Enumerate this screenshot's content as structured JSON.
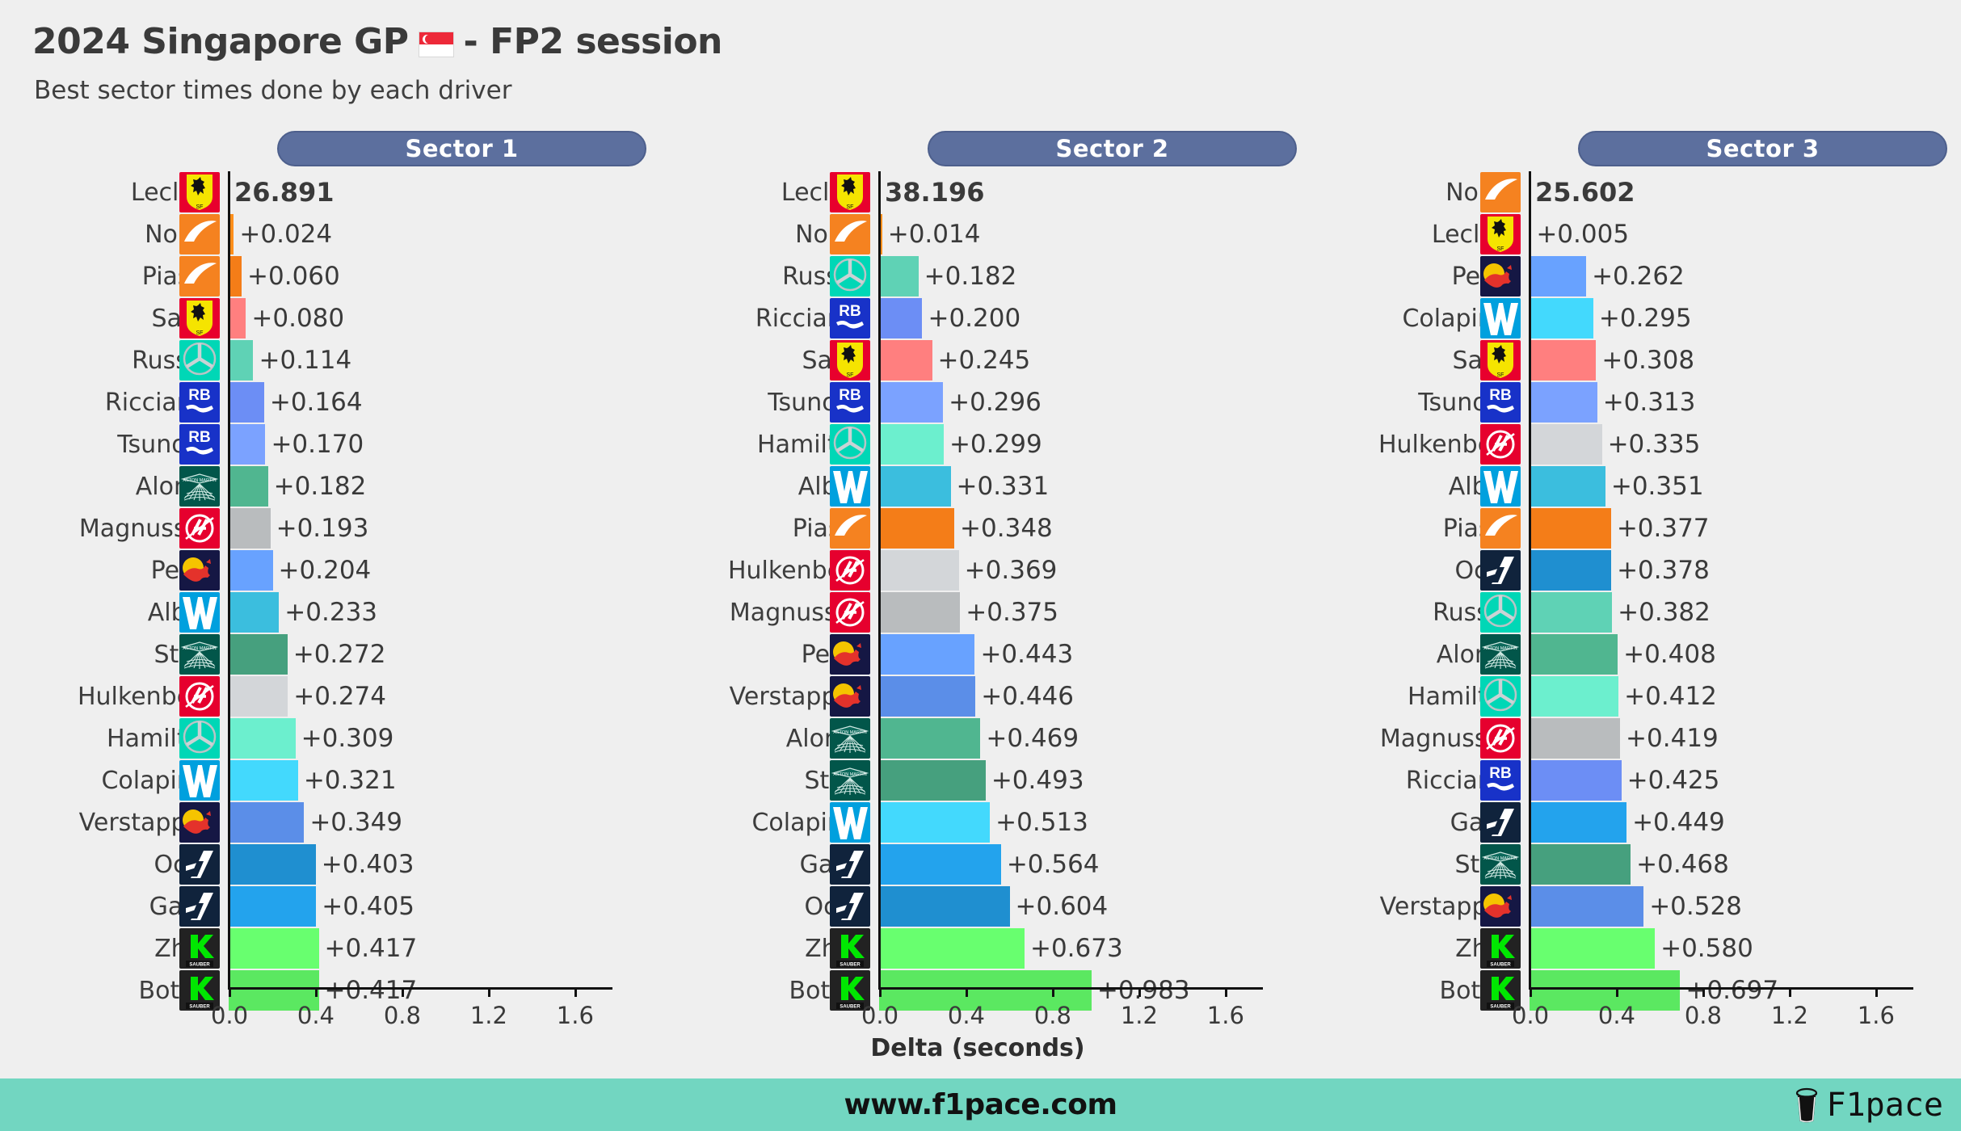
{
  "header": {
    "title_prefix": "2024 Singapore GP",
    "flag": "singapore-flag",
    "title_suffix": "- FP2 session",
    "subtitle": "Best sector times done by each driver"
  },
  "axis": {
    "xlabel": "Delta (seconds)",
    "ticks": [
      "0.0",
      "0.4",
      "0.8",
      "1.2",
      "1.6"
    ],
    "tick_values": [
      0.0,
      0.4,
      0.8,
      1.2,
      1.6
    ],
    "xlim": [
      0.0,
      1.78
    ]
  },
  "footer": {
    "url": "www.f1pace.com",
    "brand": "F1pace",
    "brand_icon": "coffee-cup-icon",
    "background": "#72d6c1"
  },
  "teams": {
    "ferrari": {
      "bar": "#ff6f6f",
      "logo_bg": "#e8002d"
    },
    "mclaren": {
      "bar": "#f47d18",
      "logo_bg": "#f58220"
    },
    "mercedes": {
      "bar": "#5fd2b5",
      "logo_bg": "#00d7b6"
    },
    "rb": {
      "bar": "#6c8ef5",
      "logo_bg": "#1832c8"
    },
    "astonmartin": {
      "bar": "#46a07e",
      "logo_bg": "#02564a"
    },
    "haas": {
      "bar": "#b9bcbe",
      "logo_bg": "#e6002e"
    },
    "redbull": {
      "bar": "#5b8ee8",
      "logo_bg": "#151744"
    },
    "williams": {
      "bar": "#3bbede",
      "logo_bg": "#00a0de"
    },
    "alpine": {
      "bar": "#1f8fd0",
      "logo_bg": "#10233c"
    },
    "sauber": {
      "bar": "#5be861",
      "logo_bg": "#222222"
    }
  },
  "chart_data": {
    "type": "bar",
    "title": "2024 Singapore GP - FP2 session",
    "subtitle": "Best sector times done by each driver",
    "xlabel": "Delta (seconds)",
    "ylabel": "",
    "xlim": [
      0.0,
      1.78
    ],
    "grid": false,
    "legend": "none",
    "orientation": "horizontal",
    "panels": [
      {
        "label": "Sector 1",
        "leader_time": "26.891",
        "rows": [
          {
            "driver": "Leclerc",
            "team": "ferrari",
            "delta": 0.0,
            "label": "26.891",
            "leader": true,
            "bar_shade": "dark"
          },
          {
            "driver": "Norris",
            "team": "mclaren",
            "delta": 0.024,
            "label": "+0.024",
            "leader": false,
            "bar_shade": "light"
          },
          {
            "driver": "Piastri",
            "team": "mclaren",
            "delta": 0.06,
            "label": "+0.060",
            "leader": false,
            "bar_shade": "dark"
          },
          {
            "driver": "Sainz",
            "team": "ferrari",
            "delta": 0.08,
            "label": "+0.080",
            "leader": false,
            "bar_shade": "light"
          },
          {
            "driver": "Russell",
            "team": "mercedes",
            "delta": 0.114,
            "label": "+0.114",
            "leader": false,
            "bar_shade": "dark"
          },
          {
            "driver": "Ricciardo",
            "team": "rb",
            "delta": 0.164,
            "label": "+0.164",
            "leader": false,
            "bar_shade": "dark"
          },
          {
            "driver": "Tsunoda",
            "team": "rb",
            "delta": 0.17,
            "label": "+0.170",
            "leader": false,
            "bar_shade": "light"
          },
          {
            "driver": "Alonso",
            "team": "astonmartin",
            "delta": 0.182,
            "label": "+0.182",
            "leader": false,
            "bar_shade": "light"
          },
          {
            "driver": "Magnussen",
            "team": "haas",
            "delta": 0.193,
            "label": "+0.193",
            "leader": false,
            "bar_shade": "dark"
          },
          {
            "driver": "Perez",
            "team": "redbull",
            "delta": 0.204,
            "label": "+0.204",
            "leader": false,
            "bar_shade": "light"
          },
          {
            "driver": "Albon",
            "team": "williams",
            "delta": 0.233,
            "label": "+0.233",
            "leader": false,
            "bar_shade": "dark"
          },
          {
            "driver": "Stroll",
            "team": "astonmartin",
            "delta": 0.272,
            "label": "+0.272",
            "leader": false,
            "bar_shade": "dark"
          },
          {
            "driver": "Hulkenberg",
            "team": "haas",
            "delta": 0.274,
            "label": "+0.274",
            "leader": false,
            "bar_shade": "light"
          },
          {
            "driver": "Hamilton",
            "team": "mercedes",
            "delta": 0.309,
            "label": "+0.309",
            "leader": false,
            "bar_shade": "light"
          },
          {
            "driver": "Colapinto",
            "team": "williams",
            "delta": 0.321,
            "label": "+0.321",
            "leader": false,
            "bar_shade": "light"
          },
          {
            "driver": "Verstappen",
            "team": "redbull",
            "delta": 0.349,
            "label": "+0.349",
            "leader": false,
            "bar_shade": "dark"
          },
          {
            "driver": "Ocon",
            "team": "alpine",
            "delta": 0.403,
            "label": "+0.403",
            "leader": false,
            "bar_shade": "dark"
          },
          {
            "driver": "Gasly",
            "team": "alpine",
            "delta": 0.405,
            "label": "+0.405",
            "leader": false,
            "bar_shade": "light"
          },
          {
            "driver": "Zhou",
            "team": "sauber",
            "delta": 0.417,
            "label": "+0.417",
            "leader": false,
            "bar_shade": "light"
          },
          {
            "driver": "Bottas",
            "team": "sauber",
            "delta": 0.417,
            "label": "+0.417",
            "leader": false,
            "bar_shade": "dark"
          }
        ]
      },
      {
        "label": "Sector 2",
        "leader_time": "38.196",
        "rows": [
          {
            "driver": "Leclerc",
            "team": "ferrari",
            "delta": 0.0,
            "label": "38.196",
            "leader": true,
            "bar_shade": "dark"
          },
          {
            "driver": "Norris",
            "team": "mclaren",
            "delta": 0.014,
            "label": "+0.014",
            "leader": false,
            "bar_shade": "light"
          },
          {
            "driver": "Russell",
            "team": "mercedes",
            "delta": 0.182,
            "label": "+0.182",
            "leader": false,
            "bar_shade": "dark"
          },
          {
            "driver": "Ricciardo",
            "team": "rb",
            "delta": 0.2,
            "label": "+0.200",
            "leader": false,
            "bar_shade": "dark"
          },
          {
            "driver": "Sainz",
            "team": "ferrari",
            "delta": 0.245,
            "label": "+0.245",
            "leader": false,
            "bar_shade": "light"
          },
          {
            "driver": "Tsunoda",
            "team": "rb",
            "delta": 0.296,
            "label": "+0.296",
            "leader": false,
            "bar_shade": "light"
          },
          {
            "driver": "Hamilton",
            "team": "mercedes",
            "delta": 0.299,
            "label": "+0.299",
            "leader": false,
            "bar_shade": "light"
          },
          {
            "driver": "Albon",
            "team": "williams",
            "delta": 0.331,
            "label": "+0.331",
            "leader": false,
            "bar_shade": "dark"
          },
          {
            "driver": "Piastri",
            "team": "mclaren",
            "delta": 0.348,
            "label": "+0.348",
            "leader": false,
            "bar_shade": "dark"
          },
          {
            "driver": "Hulkenberg",
            "team": "haas",
            "delta": 0.369,
            "label": "+0.369",
            "leader": false,
            "bar_shade": "light"
          },
          {
            "driver": "Magnussen",
            "team": "haas",
            "delta": 0.375,
            "label": "+0.375",
            "leader": false,
            "bar_shade": "dark"
          },
          {
            "driver": "Perez",
            "team": "redbull",
            "delta": 0.443,
            "label": "+0.443",
            "leader": false,
            "bar_shade": "light"
          },
          {
            "driver": "Verstappen",
            "team": "redbull",
            "delta": 0.446,
            "label": "+0.446",
            "leader": false,
            "bar_shade": "dark"
          },
          {
            "driver": "Alonso",
            "team": "astonmartin",
            "delta": 0.469,
            "label": "+0.469",
            "leader": false,
            "bar_shade": "light"
          },
          {
            "driver": "Stroll",
            "team": "astonmartin",
            "delta": 0.493,
            "label": "+0.493",
            "leader": false,
            "bar_shade": "dark"
          },
          {
            "driver": "Colapinto",
            "team": "williams",
            "delta": 0.513,
            "label": "+0.513",
            "leader": false,
            "bar_shade": "light"
          },
          {
            "driver": "Gasly",
            "team": "alpine",
            "delta": 0.564,
            "label": "+0.564",
            "leader": false,
            "bar_shade": "light"
          },
          {
            "driver": "Ocon",
            "team": "alpine",
            "delta": 0.604,
            "label": "+0.604",
            "leader": false,
            "bar_shade": "dark"
          },
          {
            "driver": "Zhou",
            "team": "sauber",
            "delta": 0.673,
            "label": "+0.673",
            "leader": false,
            "bar_shade": "light"
          },
          {
            "driver": "Bottas",
            "team": "sauber",
            "delta": 0.983,
            "label": "+0.983",
            "leader": false,
            "bar_shade": "dark"
          }
        ]
      },
      {
        "label": "Sector 3",
        "leader_time": "25.602",
        "rows": [
          {
            "driver": "Norris",
            "team": "mclaren",
            "delta": 0.0,
            "label": "25.602",
            "leader": true,
            "bar_shade": "light"
          },
          {
            "driver": "Leclerc",
            "team": "ferrari",
            "delta": 0.005,
            "label": "+0.005",
            "leader": false,
            "bar_shade": "dark"
          },
          {
            "driver": "Perez",
            "team": "redbull",
            "delta": 0.262,
            "label": "+0.262",
            "leader": false,
            "bar_shade": "light"
          },
          {
            "driver": "Colapinto",
            "team": "williams",
            "delta": 0.295,
            "label": "+0.295",
            "leader": false,
            "bar_shade": "light"
          },
          {
            "driver": "Sainz",
            "team": "ferrari",
            "delta": 0.308,
            "label": "+0.308",
            "leader": false,
            "bar_shade": "light"
          },
          {
            "driver": "Tsunoda",
            "team": "rb",
            "delta": 0.313,
            "label": "+0.313",
            "leader": false,
            "bar_shade": "light"
          },
          {
            "driver": "Hulkenberg",
            "team": "haas",
            "delta": 0.335,
            "label": "+0.335",
            "leader": false,
            "bar_shade": "light"
          },
          {
            "driver": "Albon",
            "team": "williams",
            "delta": 0.351,
            "label": "+0.351",
            "leader": false,
            "bar_shade": "dark"
          },
          {
            "driver": "Piastri",
            "team": "mclaren",
            "delta": 0.377,
            "label": "+0.377",
            "leader": false,
            "bar_shade": "dark"
          },
          {
            "driver": "Ocon",
            "team": "alpine",
            "delta": 0.378,
            "label": "+0.378",
            "leader": false,
            "bar_shade": "dark"
          },
          {
            "driver": "Russell",
            "team": "mercedes",
            "delta": 0.382,
            "label": "+0.382",
            "leader": false,
            "bar_shade": "dark"
          },
          {
            "driver": "Alonso",
            "team": "astonmartin",
            "delta": 0.408,
            "label": "+0.408",
            "leader": false,
            "bar_shade": "light"
          },
          {
            "driver": "Hamilton",
            "team": "mercedes",
            "delta": 0.412,
            "label": "+0.412",
            "leader": false,
            "bar_shade": "light"
          },
          {
            "driver": "Magnussen",
            "team": "haas",
            "delta": 0.419,
            "label": "+0.419",
            "leader": false,
            "bar_shade": "dark"
          },
          {
            "driver": "Ricciardo",
            "team": "rb",
            "delta": 0.425,
            "label": "+0.425",
            "leader": false,
            "bar_shade": "dark"
          },
          {
            "driver": "Gasly",
            "team": "alpine",
            "delta": 0.449,
            "label": "+0.449",
            "leader": false,
            "bar_shade": "light"
          },
          {
            "driver": "Stroll",
            "team": "astonmartin",
            "delta": 0.468,
            "label": "+0.468",
            "leader": false,
            "bar_shade": "dark"
          },
          {
            "driver": "Verstappen",
            "team": "redbull",
            "delta": 0.528,
            "label": "+0.528",
            "leader": false,
            "bar_shade": "dark"
          },
          {
            "driver": "Zhou",
            "team": "sauber",
            "delta": 0.58,
            "label": "+0.580",
            "leader": false,
            "bar_shade": "light"
          },
          {
            "driver": "Bottas",
            "team": "sauber",
            "delta": 0.697,
            "label": "+0.697",
            "leader": false,
            "bar_shade": "dark"
          }
        ]
      }
    ]
  }
}
